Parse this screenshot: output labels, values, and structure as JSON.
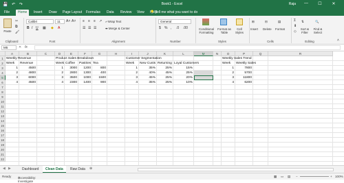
{
  "window": {
    "title": "Book1 - Excel",
    "user": "Raja",
    "controls": [
      "—",
      "☐",
      "✕"
    ]
  },
  "tabs": [
    "File",
    "Home",
    "Insert",
    "Draw",
    "Page Layout",
    "Formulas",
    "Data",
    "Review",
    "View",
    "Help"
  ],
  "active_tab": "Home",
  "tell_me": "Tell me what you want to do",
  "ribbon": {
    "paste": "Paste",
    "clipboard": "Clipboard",
    "font_name": "Calibri",
    "font_size": "11",
    "font_group": "Font",
    "wrap_text": "Wrap Text",
    "merge_center": "Merge & Center",
    "alignment": "Alignment",
    "number_format": "General",
    "number_group": "Number",
    "conditional_formatting": "Conditional Formatting",
    "format_as_table": "Format as Table",
    "cell_styles": "Cell Styles",
    "styles": "Styles",
    "insert": "Insert",
    "delete": "Delete",
    "format": "Format",
    "cells": "Cells",
    "sort_filter": "Sort & Filter",
    "find_select": "Find & Select",
    "editing": "Editing"
  },
  "formula_bar": {
    "name_box": "M5",
    "fx": "fx",
    "content": ""
  },
  "columns": [
    "A",
    "B",
    "C",
    "D",
    "E",
    "F",
    "G",
    "H",
    "I",
    "J",
    "K",
    "L",
    "M",
    "N",
    "O",
    "P",
    "Q",
    "R"
  ],
  "rows": [
    "1",
    "2",
    "3",
    "4",
    "5",
    "6",
    "7",
    "8",
    "9",
    "10",
    "11",
    "12",
    "13",
    "14",
    "15",
    "16",
    "17",
    "18",
    "19",
    "20",
    "21",
    "22"
  ],
  "cells": {
    "weekly_revenue": {
      "title": "Weekly Revenue",
      "headers": [
        "Week",
        "Revenue"
      ],
      "rows": [
        [
          "1",
          "4500"
        ],
        [
          "2",
          "4800"
        ],
        [
          "3",
          "6000"
        ],
        [
          "4",
          "4500"
        ]
      ]
    },
    "product_sales": {
      "title": "Product Sales Breakdown",
      "headers": [
        "Week",
        "Coffee",
        "Pastries",
        "Tea"
      ],
      "rows": [
        [
          "1",
          "3000",
          "1200",
          "800"
        ],
        [
          "2",
          "2800",
          "1300",
          "400"
        ],
        [
          "3",
          "3500",
          "1000",
          "1500"
        ],
        [
          "4",
          "2300",
          "1400",
          "900"
        ]
      ]
    },
    "customer_segmentation": {
      "title": "Customer Segmentation",
      "headers": [
        "Week",
        "New Custs",
        "Returning",
        "Loyal Customers"
      ],
      "rows": [
        [
          "1",
          "35%",
          "25%",
          "15%"
        ],
        [
          "2",
          "40%",
          "45%",
          "25%"
        ],
        [
          "3",
          "45%",
          "25%",
          "20%"
        ],
        [
          "4",
          "35%",
          "25%",
          "10%"
        ]
      ]
    },
    "weekly_sales_trend": {
      "title": "Weekly Sales Trend",
      "headers": [
        "Week",
        "Weekly Sales"
      ],
      "rows": [
        [
          "1",
          "7800"
        ],
        [
          "2",
          "5700"
        ],
        [
          "3",
          "11800"
        ],
        [
          "4",
          "6200"
        ]
      ]
    }
  },
  "sheet_tabs": [
    "Dashboard",
    "Clean Data",
    "Raw Data"
  ],
  "active_sheet": "Clean Data",
  "status": {
    "ready": "Ready",
    "accessibility": "Accessibility: Investigate",
    "zoom": "100%"
  },
  "colors": {
    "accent": "#217346",
    "selected_fill": "#d9d9d9"
  }
}
